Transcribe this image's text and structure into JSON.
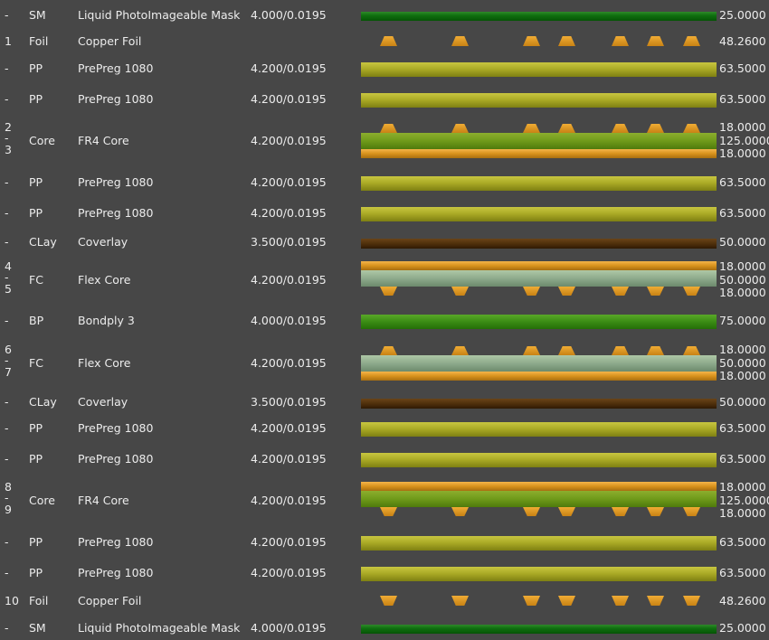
{
  "layers": [
    {
      "num": "-",
      "type": "SM",
      "material": "Liquid PhotoImageable Mask",
      "dk": "4.000/0.0195",
      "thickness": "25.0000",
      "kind": "sm"
    },
    {
      "num": "1",
      "type": "Foil",
      "material": "Copper Foil",
      "dk": "",
      "thickness": "48.2600",
      "kind": "foil",
      "pads": "up"
    },
    {
      "num": "-",
      "type": "PP",
      "material": "PrePreg 1080",
      "dk": "4.200/0.0195",
      "thickness": "63.5000",
      "kind": "pp"
    },
    {
      "num": "-",
      "type": "PP",
      "material": "PrePreg 1080",
      "dk": "4.200/0.0195",
      "thickness": "63.5000",
      "kind": "pp"
    },
    {
      "num_top": "2",
      "num_mid": "-",
      "num_bot": "3",
      "type": "Core",
      "material": "FR4 Core",
      "dk": "4.200/0.0195",
      "thk_top": "18.0000",
      "thk_mid": "125.0000",
      "thk_bot": "18.0000",
      "kind": "core",
      "pads": "top"
    },
    {
      "num": "-",
      "type": "PP",
      "material": "PrePreg 1080",
      "dk": "4.200/0.0195",
      "thickness": "63.5000",
      "kind": "pp"
    },
    {
      "num": "-",
      "type": "PP",
      "material": "PrePreg 1080",
      "dk": "4.200/0.0195",
      "thickness": "63.5000",
      "kind": "pp"
    },
    {
      "num": "-",
      "type": "CLay",
      "material": "Coverlay",
      "dk": "3.500/0.0195",
      "thickness": "50.0000",
      "kind": "clay"
    },
    {
      "num_top": "4",
      "num_mid": "-",
      "num_bot": "5",
      "type": "FC",
      "material": "Flex Core",
      "dk": "4.200/0.0195",
      "thk_top": "18.0000",
      "thk_mid": "50.0000",
      "thk_bot": "18.0000",
      "kind": "fc",
      "pads": "bottom"
    },
    {
      "num": "-",
      "type": "BP",
      "material": "Bondply 3",
      "dk": "4.000/0.0195",
      "thickness": "75.0000",
      "kind": "bp"
    },
    {
      "num_top": "6",
      "num_mid": "-",
      "num_bot": "7",
      "type": "FC",
      "material": "Flex Core",
      "dk": "4.200/0.0195",
      "thk_top": "18.0000",
      "thk_mid": "50.0000",
      "thk_bot": "18.0000",
      "kind": "fc",
      "pads": "top"
    },
    {
      "num": "-",
      "type": "CLay",
      "material": "Coverlay",
      "dk": "3.500/0.0195",
      "thickness": "50.0000",
      "kind": "clay"
    },
    {
      "num": "-",
      "type": "PP",
      "material": "PrePreg 1080",
      "dk": "4.200/0.0195",
      "thickness": "63.5000",
      "kind": "pp"
    },
    {
      "num": "-",
      "type": "PP",
      "material": "PrePreg 1080",
      "dk": "4.200/0.0195",
      "thickness": "63.5000",
      "kind": "pp"
    },
    {
      "num_top": "8",
      "num_mid": "-",
      "num_bot": "9",
      "type": "Core",
      "material": "FR4 Core",
      "dk": "4.200/0.0195",
      "thk_top": "18.0000",
      "thk_mid": "125.0000",
      "thk_bot": "18.0000",
      "kind": "core",
      "pads": "bottom"
    },
    {
      "num": "-",
      "type": "PP",
      "material": "PrePreg 1080",
      "dk": "4.200/0.0195",
      "thickness": "63.5000",
      "kind": "pp"
    },
    {
      "num": "-",
      "type": "PP",
      "material": "PrePreg 1080",
      "dk": "4.200/0.0195",
      "thickness": "63.5000",
      "kind": "pp"
    },
    {
      "num": "10",
      "type": "Foil",
      "material": "Copper Foil",
      "dk": "",
      "thickness": "48.2600",
      "kind": "foil",
      "pads": "down"
    },
    {
      "num": "-",
      "type": "SM",
      "material": "Liquid PhotoImageable Mask",
      "dk": "4.000/0.0195",
      "thickness": "25.0000",
      "kind": "sm"
    }
  ]
}
